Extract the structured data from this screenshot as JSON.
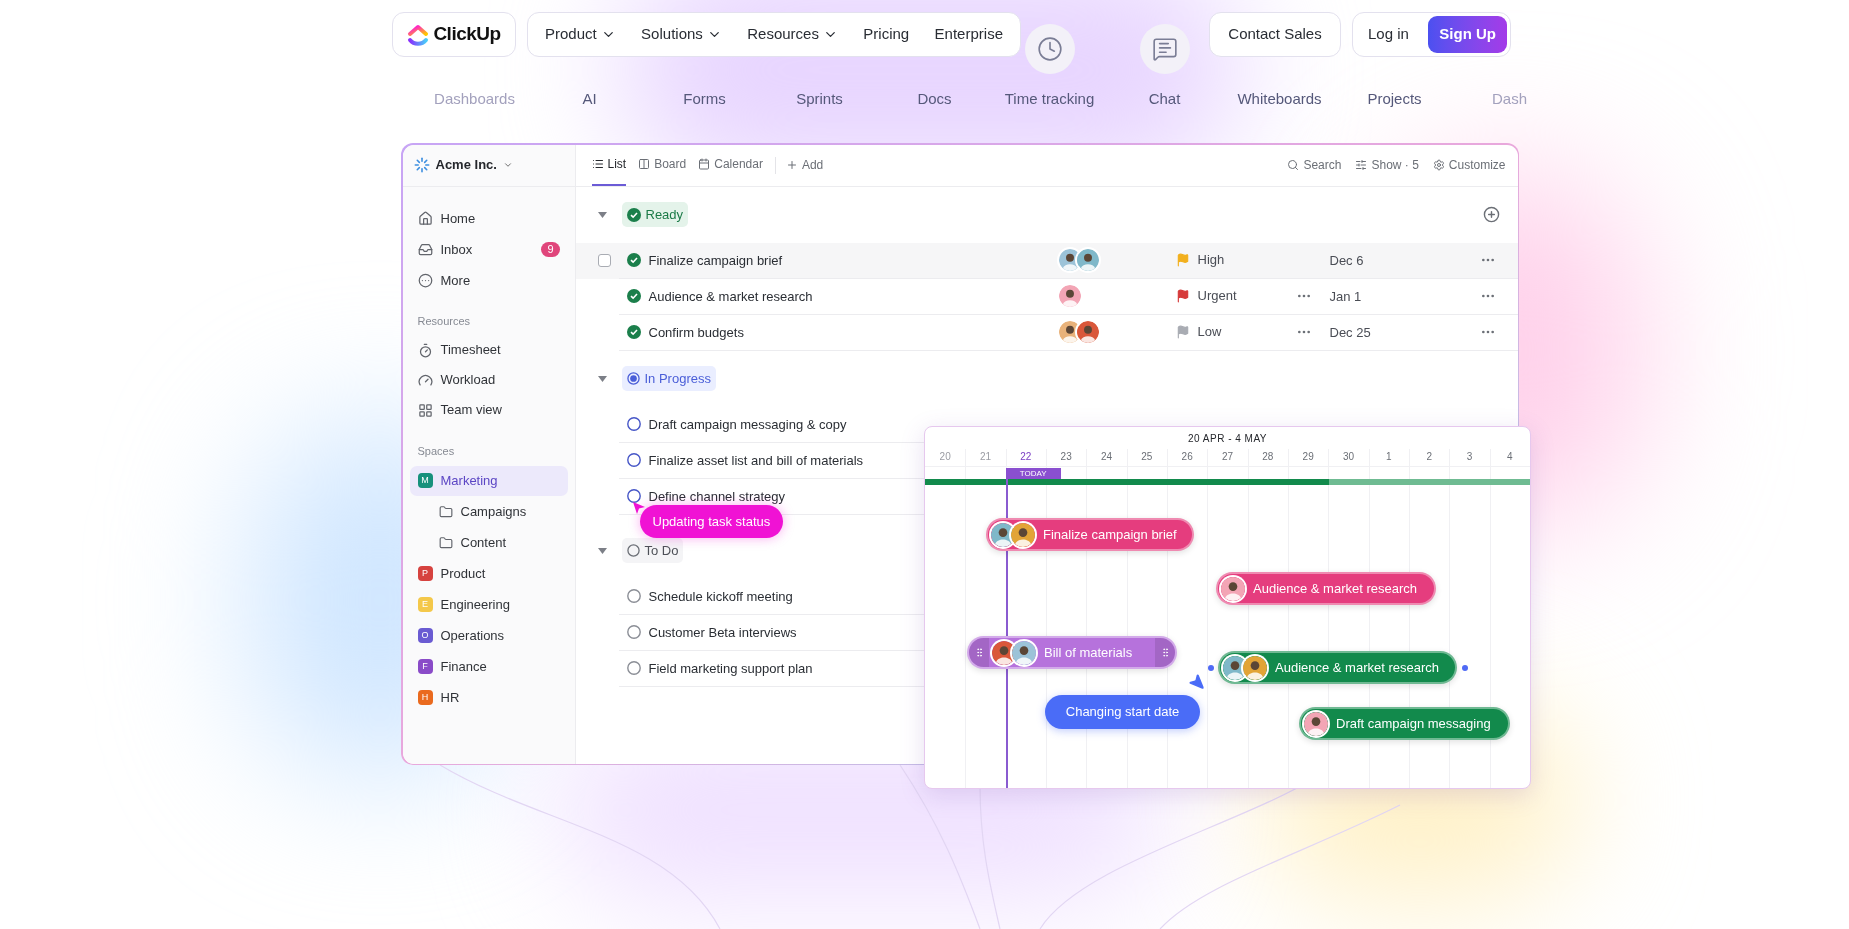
{
  "nav": {
    "logo": "ClickUp",
    "links": [
      {
        "label": "Product",
        "dropdown": true
      },
      {
        "label": "Solutions",
        "dropdown": true
      },
      {
        "label": "Resources",
        "dropdown": true
      },
      {
        "label": "Pricing",
        "dropdown": false
      },
      {
        "label": "Enterprise",
        "dropdown": false
      }
    ],
    "contact": "Contact Sales",
    "login": "Log in",
    "signup": "Sign Up"
  },
  "features": [
    {
      "label": "Dashboards",
      "faded": true
    },
    {
      "label": "AI",
      "faded": false
    },
    {
      "label": "Forms",
      "faded": false
    },
    {
      "label": "Sprints",
      "faded": false
    },
    {
      "label": "Docs",
      "faded": false
    },
    {
      "label": "Time tracking",
      "faded": false
    },
    {
      "label": "Chat",
      "faded": false
    },
    {
      "label": "Whiteboards",
      "faded": false
    },
    {
      "label": "Projects",
      "faded": false
    },
    {
      "label": "Dash",
      "faded": true
    }
  ],
  "app": {
    "workspace": "Acme Inc.",
    "main_items": [
      {
        "label": "Home"
      },
      {
        "label": "Inbox",
        "badge": "9"
      },
      {
        "label": "More"
      }
    ],
    "resources": {
      "title": "Resources",
      "items": [
        {
          "label": "Timesheet"
        },
        {
          "label": "Workload"
        },
        {
          "label": "Team view"
        }
      ]
    },
    "spaces": {
      "title": "Spaces",
      "items": [
        {
          "label": "Marketing",
          "initial": "M",
          "color": "#17917c",
          "selected": true,
          "children": [
            {
              "label": "Campaigns"
            },
            {
              "label": "Content"
            }
          ]
        },
        {
          "label": "Product",
          "initial": "P",
          "color": "#d6423f",
          "selected": false
        },
        {
          "label": "Engineering",
          "initial": "E",
          "color": "#f4c84a",
          "selected": false
        },
        {
          "label": "Operations",
          "initial": "O",
          "color": "#6a5bd2",
          "selected": false
        },
        {
          "label": "Finance",
          "initial": "F",
          "color": "#8a4bc8",
          "selected": false
        },
        {
          "label": "HR",
          "initial": "H",
          "color": "#ea6a1e",
          "selected": false
        }
      ]
    },
    "tabs": [
      {
        "label": "List",
        "selected": true
      },
      {
        "label": "Board",
        "selected": false
      },
      {
        "label": "Calendar",
        "selected": false
      }
    ],
    "add_view": "Add",
    "tools": [
      "Search",
      "Show · 5",
      "Customize"
    ],
    "groups": [
      {
        "label": "Ready",
        "kind": "done",
        "add": true,
        "tasks": [
          {
            "name": "Finalize campaign brief",
            "hovered": true,
            "priority": {
              "label": "High",
              "color": "#f2b01e"
            },
            "extra_menu": false,
            "date": "Dec 6"
          },
          {
            "name": "Audience & market research",
            "hovered": false,
            "priority": {
              "label": "Urgent",
              "color": "#d63b3b"
            },
            "extra_menu": true,
            "date": "Jan 1"
          },
          {
            "name": "Confirm budgets",
            "hovered": false,
            "priority": {
              "label": "Low",
              "color": "#a9acb3"
            },
            "extra_menu": true,
            "date": "Dec 25"
          }
        ]
      },
      {
        "label": "In Progress",
        "kind": "progress",
        "add": false,
        "tasks": [
          {
            "name": "Draft campaign messaging & copy",
            "hovered": false
          },
          {
            "name": "Finalize asset list and bill of materials",
            "hovered": false
          },
          {
            "name": "Define channel strategy",
            "hovered": false,
            "tooltip": "Updating task status"
          }
        ]
      },
      {
        "label": "To Do",
        "kind": "todo",
        "add": false,
        "tasks": [
          {
            "name": "Schedule kickoff meeting",
            "hovered": false
          },
          {
            "name": "Customer Beta interviews",
            "hovered": false
          },
          {
            "name": "Field marketing support plan",
            "hovered": false
          }
        ]
      }
    ]
  },
  "gantt": {
    "title": "20 APR - 4 MAY",
    "today_label": "TODAY",
    "days": [
      {
        "label": "20",
        "today": false
      },
      {
        "label": "21",
        "today": false
      },
      {
        "label": "22",
        "today": true
      },
      {
        "label": "23",
        "today": false
      },
      {
        "label": "24",
        "today": false
      },
      {
        "label": "25",
        "today": false
      },
      {
        "label": "26",
        "today": false
      },
      {
        "label": "27",
        "today": false
      },
      {
        "label": "28",
        "today": false
      },
      {
        "label": "29",
        "today": false
      },
      {
        "label": "30",
        "today": false
      },
      {
        "label": "1",
        "today": false
      },
      {
        "label": "2",
        "today": false
      },
      {
        "label": "3",
        "today": false
      },
      {
        "label": "4",
        "today": false
      }
    ],
    "progress": {
      "level": 0.667
    },
    "bars": [
      {
        "label": "Finalize campaign brief",
        "color": "#e53d7e",
        "handles": false,
        "connectors": false
      },
      {
        "label": "Audience & market research",
        "color": "#e53d7e",
        "handles": false,
        "connectors": false
      },
      {
        "label": "Bill of materials",
        "color": "#b672dc",
        "handles": true,
        "connectors": false
      },
      {
        "label": "Audience & market research",
        "color": "#128a4c",
        "handles": false,
        "connectors": true
      },
      {
        "label": "Draft campaign messaging",
        "color": "#128a4c",
        "handles": false,
        "connectors": false
      }
    ],
    "hint": "Changing start date"
  }
}
